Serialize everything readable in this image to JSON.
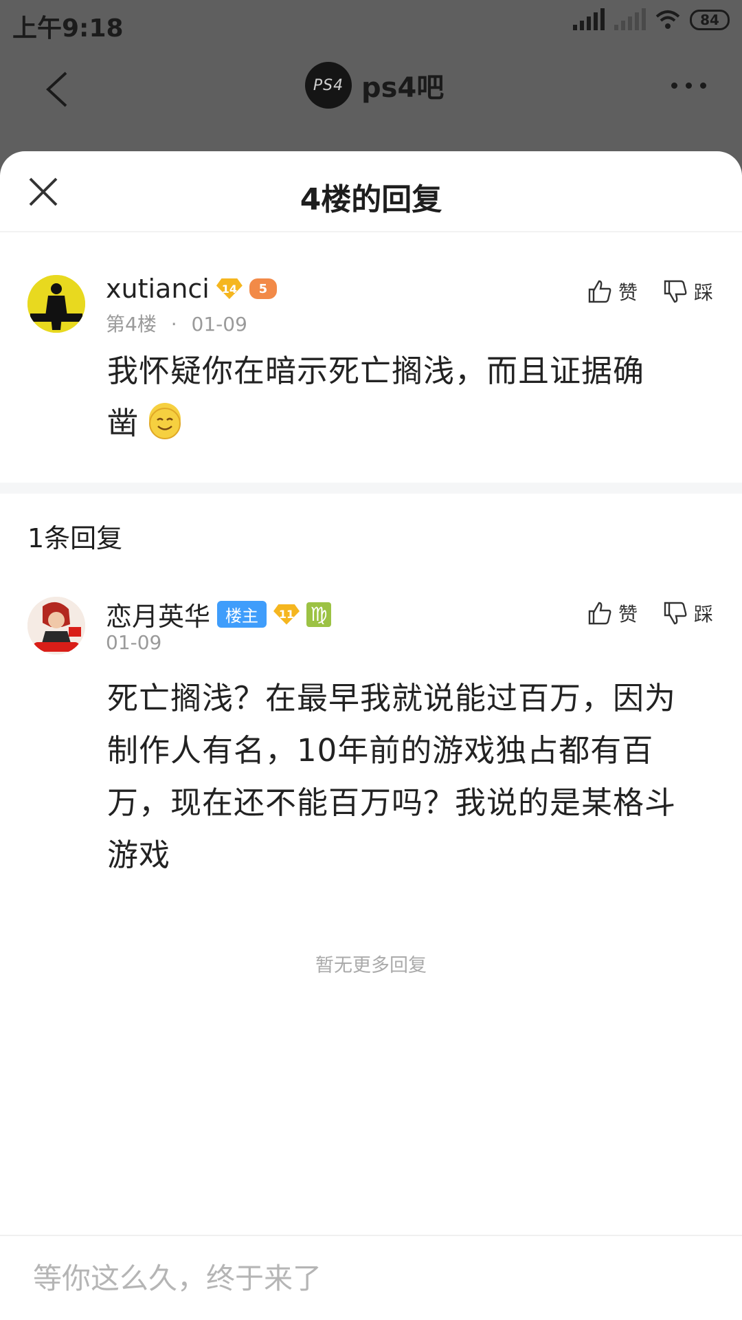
{
  "status": {
    "time": "上午9:18",
    "battery": "84"
  },
  "header": {
    "forum_name": "ps4吧",
    "forum_logo_text": "PS4"
  },
  "sheet": {
    "title": "4楼的回复"
  },
  "post": {
    "username": "xutianci",
    "level": "14",
    "game_badge": "5",
    "floor": "第4楼",
    "separator": "·",
    "date": "01-09",
    "like_label": "赞",
    "dislike_label": "踩",
    "content_line1": "我怀疑你在暗示死亡搁浅，而且证据确",
    "content_line2": "凿"
  },
  "replies": {
    "count_label": "1条回复",
    "items": [
      {
        "username": "恋月英华",
        "host_badge": "楼主",
        "level": "11",
        "zodiac": "♍",
        "date": "01-09",
        "like_label": "赞",
        "dislike_label": "踩",
        "content_lines": [
          "死亡搁浅？在最早我就说能过百万，因为",
          "制作人有名，10年前的游戏独占都有百",
          "万，现在还不能百万吗？我说的是某格斗",
          "游戏"
        ]
      }
    ],
    "end_text": "暂无更多回复"
  },
  "input": {
    "placeholder": "等你这么久，终于来了"
  },
  "colors": {
    "accent": "#3f9dfb",
    "level_badge": "#f5b61f",
    "overlay": "#5f5f5f"
  }
}
